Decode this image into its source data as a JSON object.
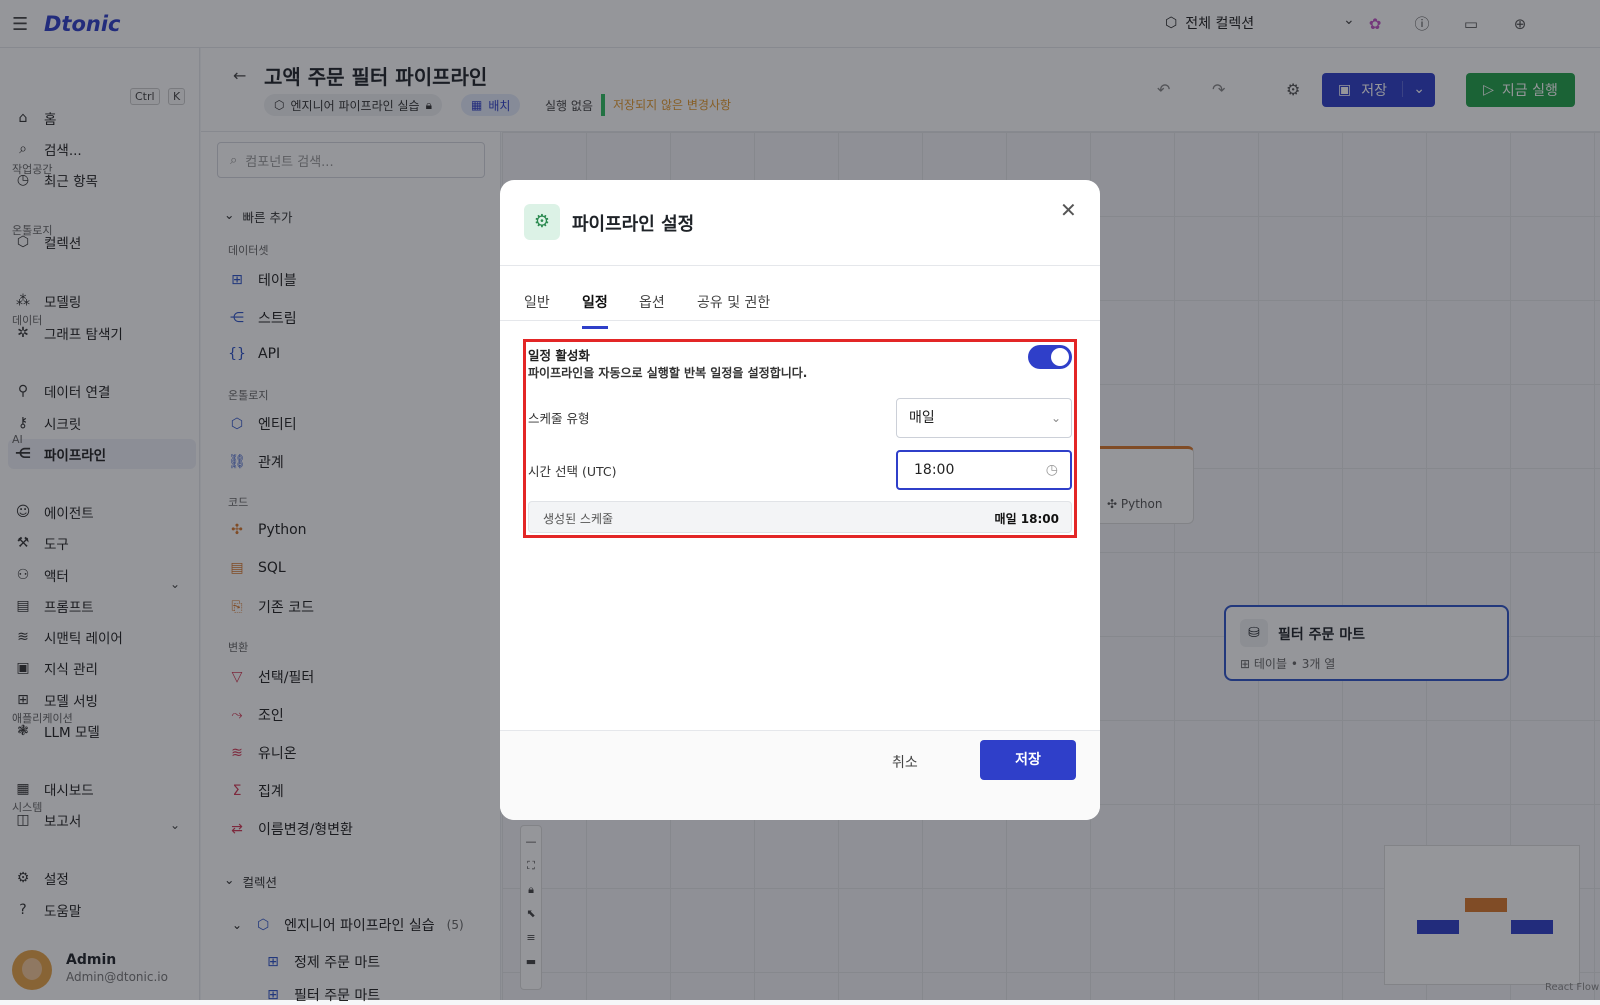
{
  "app": {
    "logo": "Dtonic",
    "collection_label": "전체 컬렉션"
  },
  "sidebar": {
    "items": [
      {
        "label": "홈",
        "icon": "home-icon"
      },
      {
        "label": "검색...",
        "icon": "search-icon"
      },
      {
        "label": "최근 항목",
        "icon": "clock-icon"
      },
      {
        "label": "컬렉션",
        "icon": "cube-icon"
      },
      {
        "label": "모델링",
        "icon": "nodes-icon"
      },
      {
        "label": "그래프 탐색기",
        "icon": "graph-icon"
      },
      {
        "label": "데이터 연결",
        "icon": "plug-icon"
      },
      {
        "label": "시크릿",
        "icon": "key-icon"
      },
      {
        "label": "파이프라인",
        "icon": "pipeline-icon"
      },
      {
        "label": "에이전트",
        "icon": "robot-icon"
      },
      {
        "label": "도구",
        "icon": "wrench-icon"
      },
      {
        "label": "액터",
        "icon": "person-icon"
      },
      {
        "label": "프롬프트",
        "icon": "document-icon"
      },
      {
        "label": "시맨틱 레이어",
        "icon": "layers-icon"
      },
      {
        "label": "지식 관리",
        "icon": "book-icon"
      },
      {
        "label": "모델 서빙",
        "icon": "chip-icon"
      },
      {
        "label": "LLM 모델",
        "icon": "brain-icon"
      },
      {
        "label": "대시보드",
        "icon": "dashboard-icon"
      },
      {
        "label": "보고서",
        "icon": "report-icon"
      },
      {
        "label": "설정",
        "icon": "gear-icon"
      },
      {
        "label": "도움말",
        "icon": "help-icon"
      }
    ],
    "sections": [
      "작업공간",
      "온톨로지",
      "데이터",
      "AI",
      "애플리케이션",
      "시스템"
    ],
    "kbd": [
      "Ctrl",
      "K"
    ],
    "user": {
      "name": "Admin",
      "email": "Admin@dtonic.io"
    }
  },
  "pipeline": {
    "title": "고액 주문 필터 파이프라인",
    "chip1": "엔지니어 파이프라인 실습",
    "chip2": "배치",
    "no_exec": "실행 없음",
    "unsaved": "저장되지 않은 변경사항",
    "save_label": "저장",
    "run_label": "지금 실행"
  },
  "panel": {
    "search_placeholder": "컴포넌트 검색...",
    "quick_add": "빠른 추가",
    "sections": [
      "데이터셋",
      "온톨로지",
      "코드",
      "변환"
    ],
    "items": [
      "테이블",
      "스트림",
      "API",
      "엔티티",
      "관계",
      "Python",
      "SQL",
      "기존 코드",
      "선택/필터",
      "조인",
      "유니온",
      "집계",
      "이름변경/형변환"
    ],
    "collections": "컬렉션",
    "collection_name": "엔지니어 파이프라인 실습",
    "collection_count": "(5)",
    "col_items": [
      "정제 주문 마트",
      "필터 주문 마트"
    ]
  },
  "canvas": {
    "node1_label": "Python",
    "node2_title": "필터 주문 마트",
    "node2_sub": "테이블 • 3개 열",
    "react_flow": "React Flow"
  },
  "modal": {
    "title": "파이프라인 설정",
    "tabs": [
      "일반",
      "일정",
      "옵션",
      "공유 및 권한"
    ],
    "enable_title": "일정 활성화",
    "enable_desc": "파이프라인을 자동으로 실행할 반복 일정을 설정합니다.",
    "enabled": true,
    "schedule_type_label": "스케줄 유형",
    "schedule_type_value": "매일",
    "time_label": "시간 선택 (UTC)",
    "time_value": "18:00",
    "generated_label": "생성된 스케줄",
    "generated_value": "매일 18:00",
    "cancel": "취소",
    "save": "저장"
  },
  "colors": {
    "accent": "#2f3fc9",
    "run": "#22a34a",
    "highlight": "#e32626",
    "unsaved": "#e59b2e"
  }
}
